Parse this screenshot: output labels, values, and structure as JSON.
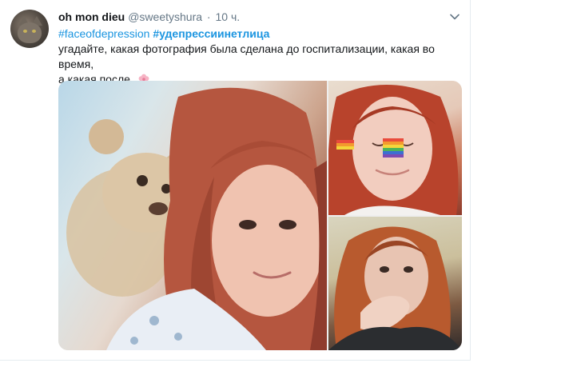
{
  "tweet": {
    "display_name": "oh mon dieu",
    "handle": "@sweetyshura",
    "separator": "·",
    "time": "10 ч.",
    "hashtags": [
      "#faceofdepression",
      "#удепрессиинетлица"
    ],
    "text_line1": "угадайте, какая фотография была сделана до госпитализации, какая во время,",
    "text_line2": "а какая после.",
    "emoji": "flower-emoji"
  },
  "icons": {
    "avatar": "cat-avatar",
    "more": "chevron-down-icon"
  },
  "colors": {
    "link": "#1b95e0",
    "name": "#14171a",
    "muted": "#657786"
  },
  "media": {
    "photos": [
      {
        "label": "photo-1"
      },
      {
        "label": "photo-2"
      },
      {
        "label": "photo-3"
      }
    ]
  }
}
